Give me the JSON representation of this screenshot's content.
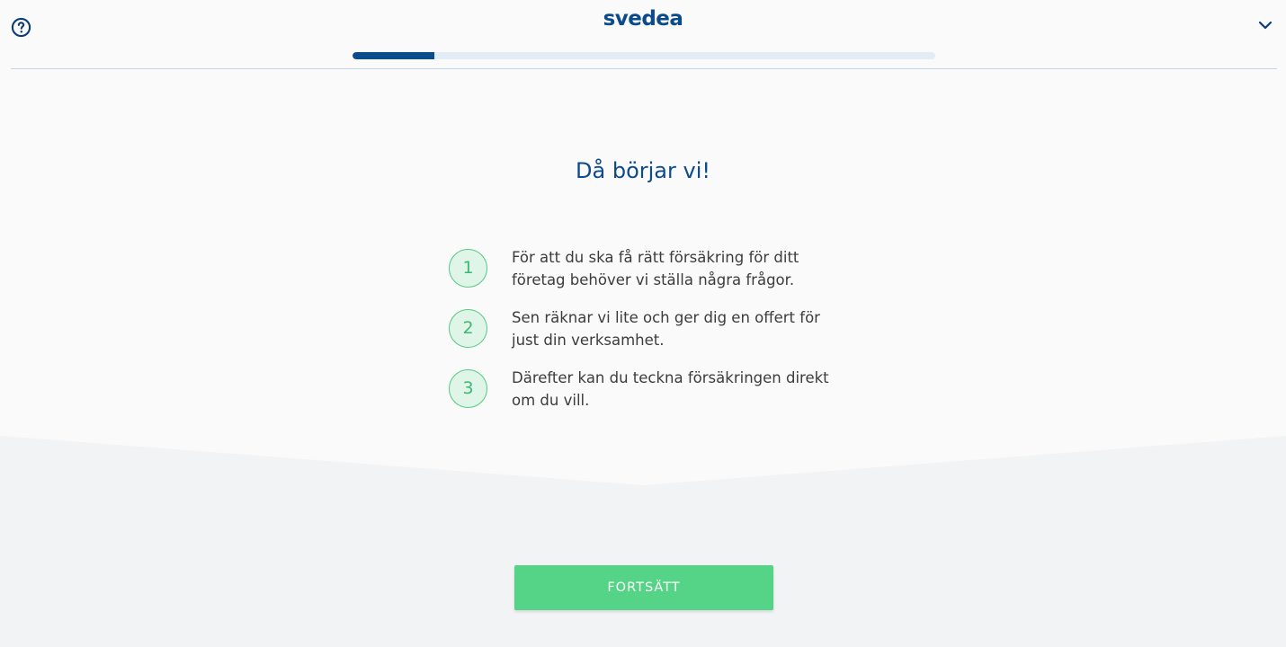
{
  "header": {
    "logo_text": "svedea",
    "progress_fraction": 0.14,
    "help_icon": "help-circle-icon",
    "menu_icon": "chevron-down-icon"
  },
  "main": {
    "title": "Då börjar vi!",
    "steps": [
      {
        "number": "1",
        "text": "För att du ska få rätt försäkring för ditt företag behöver vi ställa några frågor."
      },
      {
        "number": "2",
        "text": "Sen räknar vi lite och ger dig en offert för just din verksamhet."
      },
      {
        "number": "3",
        "text": "Därefter kan du teckna försäkringen direkt om du vill."
      }
    ]
  },
  "footer": {
    "continue_label": "FORTSÄTT"
  },
  "colors": {
    "brand": "#0b4a8b",
    "accent_green": "#55d386",
    "progress_track": "#e2ecf5"
  }
}
